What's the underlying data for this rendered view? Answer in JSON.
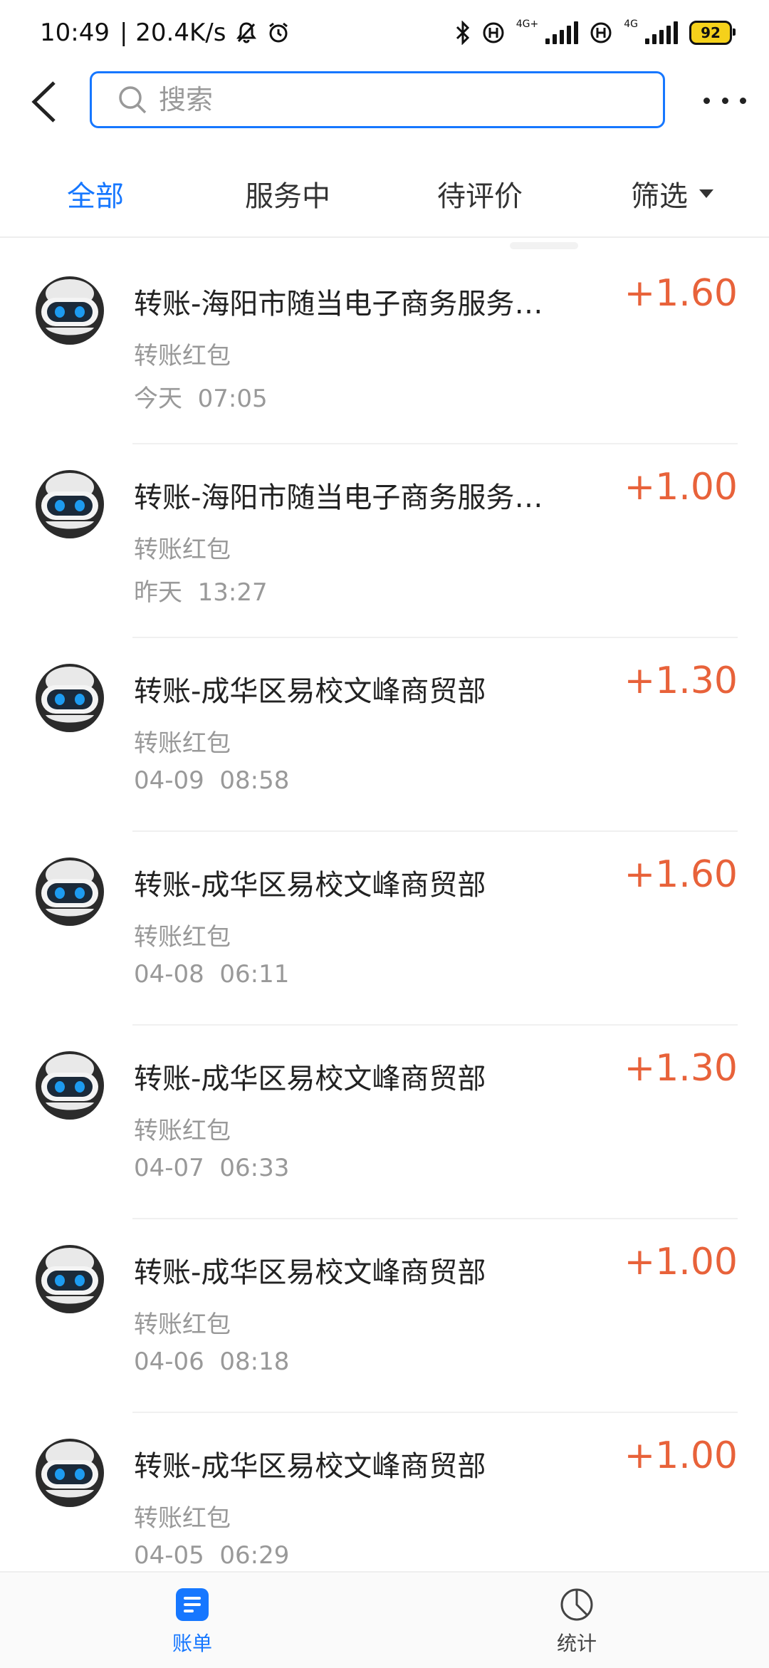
{
  "status_bar": {
    "time": "10:49",
    "speed": "| 20.4K/s",
    "net1": "4G+",
    "net2": "4G",
    "battery": "92"
  },
  "search": {
    "placeholder": "搜索"
  },
  "tabs": [
    {
      "label": "全部",
      "active": true
    },
    {
      "label": "服务中"
    },
    {
      "label": "待评价"
    },
    {
      "label": "筛选"
    }
  ],
  "transactions": [
    {
      "title": "转账-海阳市随当电子商务服务有限公司",
      "type": "转账红包",
      "time": "今天  07:05",
      "amount": "+1.60"
    },
    {
      "title": "转账-海阳市随当电子商务服务有限公司",
      "type": "转账红包",
      "time": "昨天  13:27",
      "amount": "+1.00"
    },
    {
      "title": "转账-成华区易校文峰商贸部",
      "type": "转账红包",
      "time": "04-09  08:58",
      "amount": "+1.30"
    },
    {
      "title": "转账-成华区易校文峰商贸部",
      "type": "转账红包",
      "time": "04-08  06:11",
      "amount": "+1.60"
    },
    {
      "title": "转账-成华区易校文峰商贸部",
      "type": "转账红包",
      "time": "04-07  06:33",
      "amount": "+1.30"
    },
    {
      "title": "转账-成华区易校文峰商贸部",
      "type": "转账红包",
      "time": "04-06  08:18",
      "amount": "+1.00"
    },
    {
      "title": "转账-成华区易校文峰商贸部",
      "type": "转账红包",
      "time": "04-05  06:29",
      "amount": "+1.00"
    }
  ],
  "bottom_nav": [
    {
      "label": "账单",
      "active": true
    },
    {
      "label": "统计"
    }
  ],
  "colors": {
    "accent": "#1677ff",
    "amount": "#e8623a"
  }
}
